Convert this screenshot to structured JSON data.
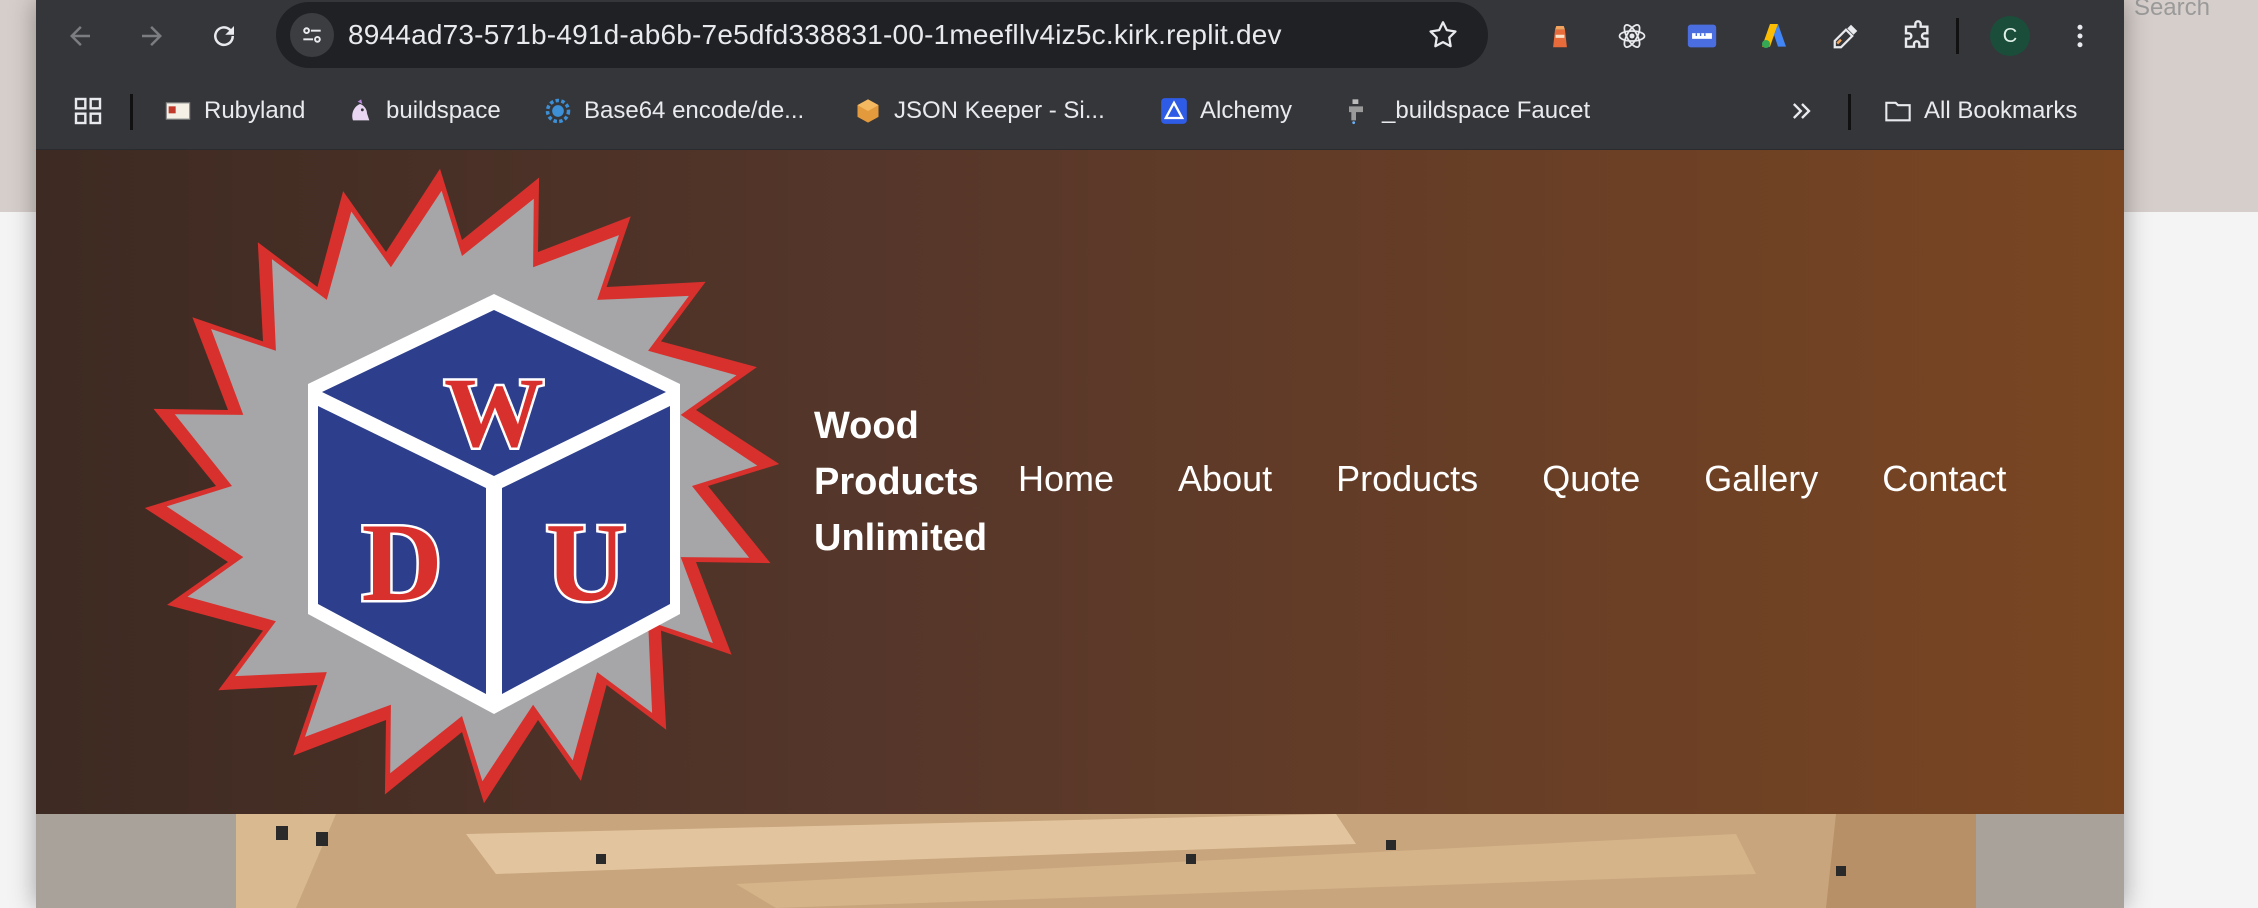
{
  "desktop": {
    "search_hint": "Search"
  },
  "browser": {
    "url": "8944ad73-571b-491d-ab6b-7e5dfd338831-00-1meefllv4iz5c.kirk.replit.dev",
    "profile_initial": "C",
    "icons": [
      "back-icon",
      "forward-icon",
      "reload-icon",
      "site-info-icon",
      "bookmark-star-icon",
      "extension-lighthouse-icon",
      "extension-react-icon",
      "extension-ruler-icon",
      "extension-ads-icon",
      "extension-eyedropper-icon",
      "extensions-puzzle-icon",
      "menu-kebab-icon"
    ]
  },
  "bookmarks": {
    "items": [
      {
        "label": "Rubyland",
        "icon": "rubyland-icon"
      },
      {
        "label": "buildspace",
        "icon": "buildspace-icon"
      },
      {
        "label": "Base64 encode/de...",
        "icon": "base64-icon"
      },
      {
        "label": "JSON Keeper - Si...",
        "icon": "json-keeper-icon"
      },
      {
        "label": "Alchemy",
        "icon": "alchemy-icon"
      },
      {
        "label": "_buildspace Faucet",
        "icon": "faucet-icon"
      }
    ],
    "all_label": "All Bookmarks"
  },
  "site": {
    "logo_letters": {
      "top": "W",
      "left": "D",
      "right": "U"
    },
    "brand_line1": "Wood",
    "brand_line2": "Products",
    "brand_line3": "Unlimited",
    "nav": [
      "Home",
      "About",
      "Products",
      "Quote",
      "Gallery",
      "Contact"
    ]
  },
  "colors": {
    "header_start": "#3d2a22",
    "header_end": "#7a4622",
    "logo_red": "#d8302c",
    "logo_blue": "#2c3e8c",
    "logo_gray": "#a6a5a8"
  }
}
